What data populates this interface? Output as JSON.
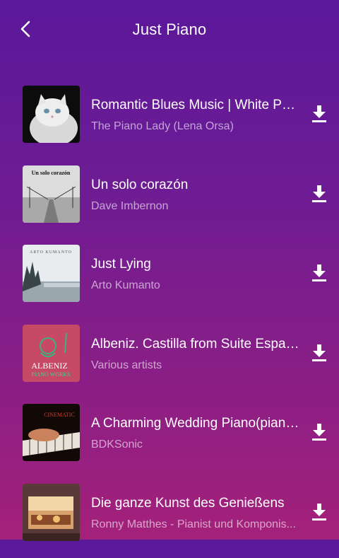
{
  "header": {
    "title": "Just Piano",
    "back_icon": "chevron-left-icon"
  },
  "colors": {
    "gradient_top": "#5a189a",
    "gradient_bottom": "#a4217a",
    "text": "#ffffff",
    "subtext": "rgba(255,255,255,0.6)"
  },
  "songs": [
    {
      "title": "Romantic Blues Music | White Per...",
      "artist": "The Piano Lady (Lena Orsa)",
      "action_icon": "download-icon"
    },
    {
      "title": "Un solo corazón",
      "artist": "Dave Imbernon",
      "cover_text": "Un solo corazón",
      "action_icon": "download-icon"
    },
    {
      "title": "Just Lying",
      "artist": "Arto Kumanto",
      "cover_text": "ARTO KUMANTO",
      "action_icon": "download-icon"
    },
    {
      "title": "Albeniz. Castilla from Suite Espag...",
      "artist": "Various artists",
      "cover_text": "ALBENIZ",
      "cover_subtext": "PIANO WORKS",
      "action_icon": "download-icon"
    },
    {
      "title": "A Charming Wedding Piano(piano...",
      "artist": "BDKSonic",
      "cover_text": "CINEMATIC",
      "action_icon": "download-icon"
    },
    {
      "title": "Die ganze Kunst des Genießens",
      "artist": "Ronny Matthes - Pianist und Komponis...",
      "action_icon": "download-icon"
    }
  ]
}
